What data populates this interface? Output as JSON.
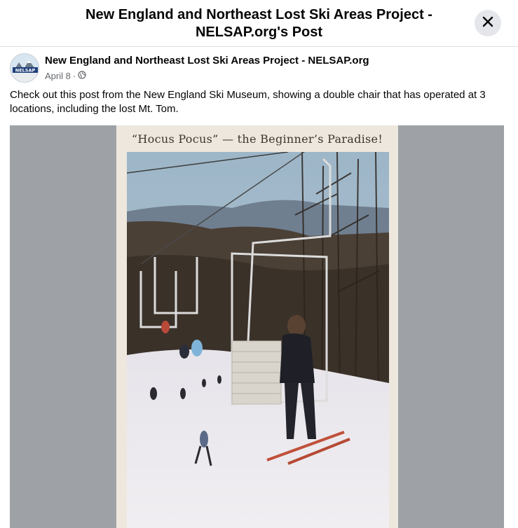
{
  "dialog": {
    "title": "New England and Northeast Lost Ski Areas Project - NELSAP.org's Post",
    "close_icon": "close-icon"
  },
  "post": {
    "page_name": "New England and Northeast Lost Ski Areas Project - NELSAP.org",
    "date": "April 8",
    "separator": "·",
    "privacy_icon": "globe-icon",
    "avatar_text": "NELSAP",
    "text": "Check out this post from the New England Ski Museum, showing a double chair that has operated at 3 locations, including the lost Mt. Tom.",
    "image": {
      "caption": "“Hocus Pocus” — the Beginner’s Paradise!"
    }
  },
  "colors": {
    "secondary_text": "#65676b",
    "close_bg": "#e4e6eb",
    "media_bg": "#9ea2a7"
  }
}
